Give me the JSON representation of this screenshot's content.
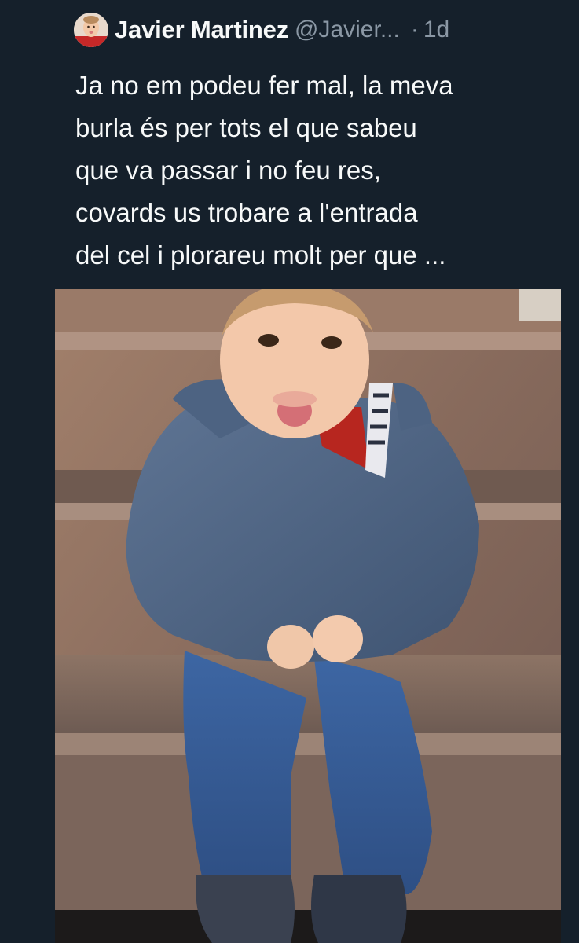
{
  "tweet": {
    "author_name": "Javier Martinez",
    "author_handle": "@Javier...",
    "separator": "·",
    "time": "1d",
    "text_lines": [
      "Ja no em podeu fer mal, la meva",
      "burla és per tots el que sabeu",
      "que va passar i no feu res,",
      "covards us trobare a l'entrada",
      "del cel i plorareu molt per que ..."
    ],
    "avatar_icon": "profile-photo-avatar",
    "media_icon": "photo-toddler-on-stairs"
  },
  "theme": {
    "background": "#15202b",
    "text_primary": "#f7f9f9",
    "text_secondary": "#8b98a5"
  }
}
